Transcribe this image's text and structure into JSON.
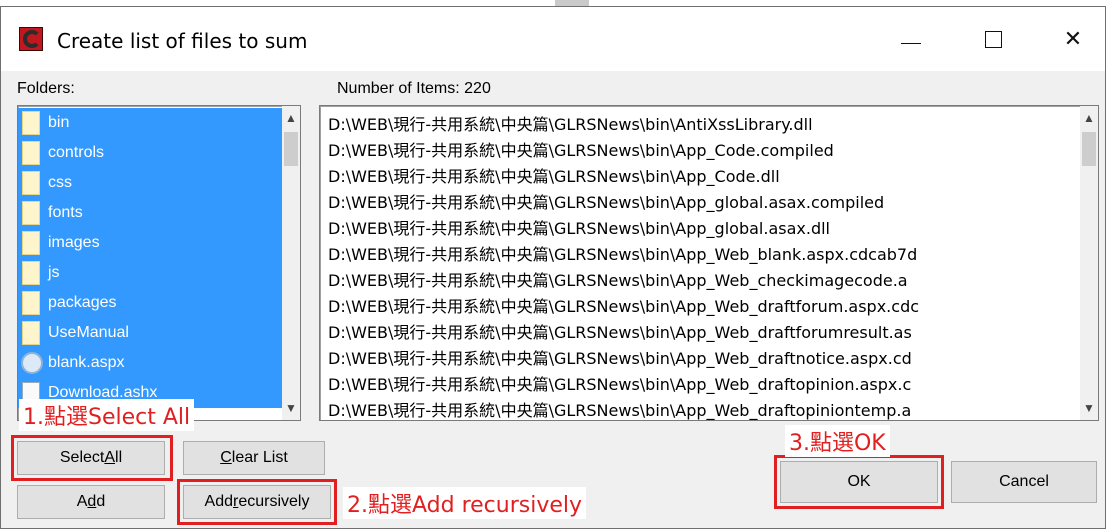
{
  "window": {
    "title": "Create list of files to sum",
    "controls": {
      "minimize": "—",
      "maximize": "☐",
      "close": "✕"
    }
  },
  "folders": {
    "label": "Folders:",
    "items": [
      {
        "name": "bin",
        "icon": "folder"
      },
      {
        "name": "controls",
        "icon": "folder"
      },
      {
        "name": "css",
        "icon": "folder"
      },
      {
        "name": "fonts",
        "icon": "folder"
      },
      {
        "name": "images",
        "icon": "folder"
      },
      {
        "name": "js",
        "icon": "folder"
      },
      {
        "name": "packages",
        "icon": "folder"
      },
      {
        "name": "UseManual",
        "icon": "folder"
      },
      {
        "name": "blank.aspx",
        "icon": "globe"
      },
      {
        "name": "Download.ashx",
        "icon": "doc"
      }
    ]
  },
  "files": {
    "count_label": "Number of Items: 220",
    "items": [
      "D:\\WEB\\現行-共用系統\\中央篇\\GLRSNews\\bin\\AntiXssLibrary.dll",
      "D:\\WEB\\現行-共用系統\\中央篇\\GLRSNews\\bin\\App_Code.compiled",
      "D:\\WEB\\現行-共用系統\\中央篇\\GLRSNews\\bin\\App_Code.dll",
      "D:\\WEB\\現行-共用系統\\中央篇\\GLRSNews\\bin\\App_global.asax.compiled",
      "D:\\WEB\\現行-共用系統\\中央篇\\GLRSNews\\bin\\App_global.asax.dll",
      "D:\\WEB\\現行-共用系統\\中央篇\\GLRSNews\\bin\\App_Web_blank.aspx.cdcab7d",
      "D:\\WEB\\現行-共用系統\\中央篇\\GLRSNews\\bin\\App_Web_checkimagecode.a",
      "D:\\WEB\\現行-共用系統\\中央篇\\GLRSNews\\bin\\App_Web_draftforum.aspx.cdc",
      "D:\\WEB\\現行-共用系統\\中央篇\\GLRSNews\\bin\\App_Web_draftforumresult.as",
      "D:\\WEB\\現行-共用系統\\中央篇\\GLRSNews\\bin\\App_Web_draftnotice.aspx.cd",
      "D:\\WEB\\現行-共用系統\\中央篇\\GLRSNews\\bin\\App_Web_draftopinion.aspx.c",
      "D:\\WEB\\現行-共用系統\\中央篇\\GLRSNews\\bin\\App_Web_draftopiniontemp.a"
    ]
  },
  "buttons": {
    "select_all": {
      "pre": "Select ",
      "accel": "A",
      "post": "ll"
    },
    "clear_list": {
      "pre": "",
      "accel": "C",
      "post": "lear List"
    },
    "add": {
      "pre": "A",
      "accel": "d",
      "post": "d"
    },
    "add_recursively": {
      "pre": "Add ",
      "accel": "r",
      "post": "ecursively"
    },
    "ok": "OK",
    "cancel": "Cancel"
  },
  "annotations": {
    "step1": "1.點選Select All",
    "step2": "2.點選Add recursively",
    "step3": "3.點選OK",
    "color": "#e02020"
  },
  "colors": {
    "selection": "#3399ff",
    "window_bg": "#f0f0f0"
  }
}
